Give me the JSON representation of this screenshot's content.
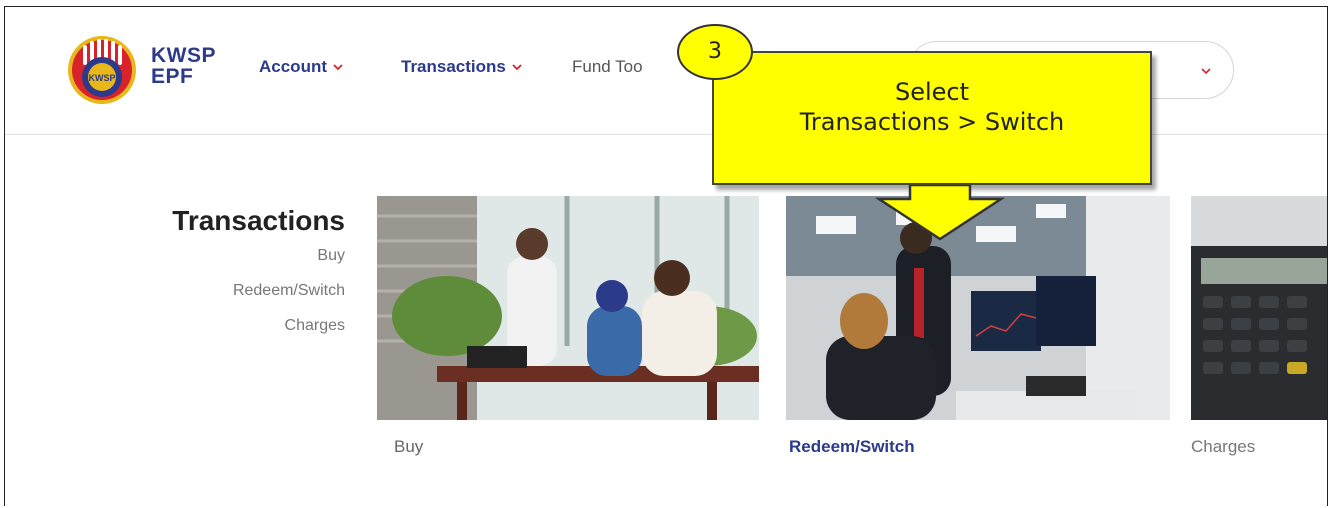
{
  "logo": {
    "line1": "KWSP",
    "line2": "EPF",
    "badge_text": "KWSP",
    "colors": {
      "primary": "#2c3a8c",
      "accent": "#d8232a",
      "gold": "#e8b81a"
    }
  },
  "nav": {
    "items": [
      {
        "label": "Account",
        "icon": "chevron-down-icon"
      },
      {
        "label": "Transactions",
        "icon": "chevron-down-icon"
      },
      {
        "label": "Fund Too"
      }
    ],
    "select_icon": "chevron-down-icon"
  },
  "sidebar": {
    "title": "Transactions",
    "links": [
      "Buy",
      "Redeem/Switch",
      "Charges"
    ]
  },
  "cards": [
    {
      "label": "Buy",
      "image": "office-meeting-photo",
      "active": false
    },
    {
      "label": "Redeem/Switch",
      "image": "trading-screens-photo",
      "active": true
    },
    {
      "label": "Charges",
      "image": "calculator-photo",
      "active": false
    }
  ],
  "annotation": {
    "step": "3",
    "line1": "Select",
    "line2": "Transactions > Switch",
    "color": "#ffff00"
  }
}
